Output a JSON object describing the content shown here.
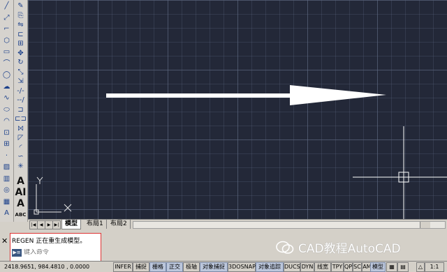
{
  "toolbars": {
    "draw_icons": [
      "line-icon",
      "construction-line-icon",
      "polyline-icon",
      "polygon-icon",
      "rectangle-icon",
      "arc-icon",
      "circle-icon",
      "revision-cloud-icon",
      "spline-icon",
      "ellipse-icon",
      "ellipse-arc-icon",
      "insert-block-icon",
      "make-block-icon",
      "point-icon",
      "hatch-icon",
      "gradient-icon",
      "region-icon",
      "table-icon",
      "multiline-text-icon"
    ],
    "modify_icons": [
      "erase-icon",
      "copy-icon",
      "mirror-icon",
      "offset-icon",
      "array-icon",
      "move-icon",
      "rotate-icon",
      "scale-icon",
      "stretch-icon",
      "trim-icon",
      "extend-icon",
      "break-at-point-icon",
      "break-icon",
      "join-icon",
      "chamfer-icon",
      "fillet-icon",
      "blend-icon",
      "explode-icon"
    ],
    "text_glyphs": [
      "A",
      "AI",
      "A",
      "ABC"
    ]
  },
  "layout_tabs": [
    "模型",
    "布局1",
    "布局2"
  ],
  "axis_labels": {
    "x": "X",
    "y": "Y"
  },
  "command": {
    "close_glyph": "✕",
    "history_line": "REGEN 正在重生成模型。",
    "prompt_icon": "▶≡",
    "placeholder": "键入命令"
  },
  "watermark": "CAD教程AutoCAD",
  "status": {
    "coordinates": "2418.9651, 984.4810 , 0.0000",
    "toggles": [
      {
        "label": "INFER",
        "on": false
      },
      {
        "label": "捕捉",
        "on": false
      },
      {
        "label": "栅格",
        "on": true
      },
      {
        "label": "正交",
        "on": true
      },
      {
        "label": "极轴",
        "on": false
      },
      {
        "label": "对象捕捉",
        "on": true
      },
      {
        "label": "3DOSNAP",
        "on": false
      },
      {
        "label": "对象追踪",
        "on": true
      },
      {
        "label": "DUCS",
        "on": false
      },
      {
        "label": "DYN",
        "on": false
      },
      {
        "label": "线宽",
        "on": false
      },
      {
        "label": "TPY",
        "on": false
      },
      {
        "label": "QP",
        "on": false
      },
      {
        "label": "SC",
        "on": false
      },
      {
        "label": "AM",
        "on": false
      }
    ],
    "model_label": "模型",
    "scale": "1:1"
  },
  "colors": {
    "canvas_bg": "#232838",
    "arrow": "#ffffff",
    "crosshair": "#ffffff",
    "toggle_on": "#bcc7dc"
  }
}
